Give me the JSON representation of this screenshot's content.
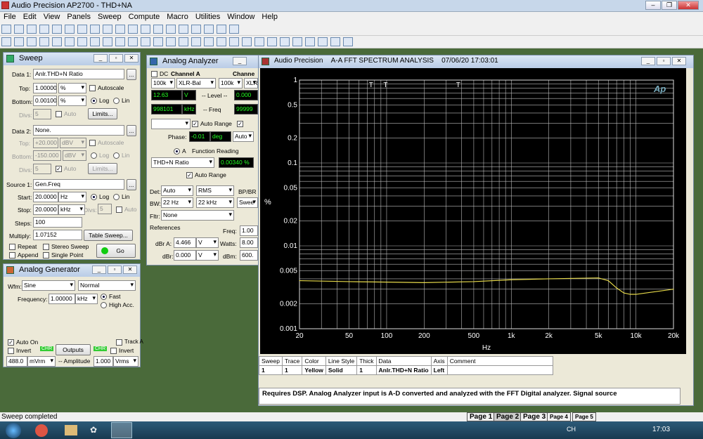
{
  "app": {
    "title": "Audio Precision AP2700 - THD+NA"
  },
  "menu": [
    "File",
    "Edit",
    "View",
    "Panels",
    "Sweep",
    "Compute",
    "Macro",
    "Utilities",
    "Window",
    "Help"
  ],
  "sweep": {
    "title": "Sweep",
    "data1_label": "Data 1:",
    "data1_value": "Anlr.THD+N Ratio",
    "top_label": "Top:",
    "top_value": "1.00000",
    "top_unit": "%",
    "bottom_label": "Bottom:",
    "bottom_value": "0.00100",
    "bottom_unit": "%",
    "autoscale": "Autoscale",
    "log": "Log",
    "lin": "Lin",
    "divs_label": "Divs:",
    "divs_value": "5",
    "auto": "Auto",
    "limits": "Limits...",
    "data2_label": "Data 2:",
    "data2_value": "None.",
    "top2_value": "+20.000",
    "top2_unit": "dBV",
    "bottom2_value": "-150.000",
    "bottom2_unit": "dBV",
    "divs2_value": "5",
    "source1_label": "Source 1:",
    "source1_value": "Gen.Freq",
    "start_label": "Start:",
    "start_value": "20.0000",
    "start_unit": "Hz",
    "stop_label": "Stop:",
    "stop_value": "20.0000",
    "stop_unit": "kHz",
    "divs3_value": "5",
    "steps_label": "Steps:",
    "steps_value": "100",
    "multiply_label": "Multiply:",
    "multiply_value": "1.07152",
    "table_sweep": "Table Sweep...",
    "repeat": "Repeat",
    "stereo_sweep": "Stereo Sweep",
    "append": "Append",
    "single_point": "Single Point",
    "go": "Go"
  },
  "generator": {
    "title": "Analog Generator",
    "wfm_label": "Wfm:",
    "wfm_value": "Sine",
    "wfm2_value": "Normal",
    "freq_label": "Frequency:",
    "freq_value": "1.00000",
    "freq_unit": "kHz",
    "fast": "Fast",
    "high_acc": "High Acc.",
    "auto_on": "Auto On",
    "invert": "Invert",
    "track_a": "Track A",
    "invert2": "Invert",
    "chr": "CHR",
    "outputs": "Outputs",
    "amp_value": "488.0",
    "amp_unit": "mVrm",
    "amp_label": "-- Amplitude",
    "amp2_value": "1.000",
    "amp2_unit": "Vrms"
  },
  "analyzer": {
    "title": "Analog Analyzer",
    "dc": "DC",
    "channel_a": "Channel A",
    "chan_b": "Channe",
    "range1": "100k",
    "input": "XLR-Bal",
    "range2": "100k",
    "input2": "XLR",
    "level_value": "12.63",
    "level_unit": "V",
    "level_label": "-- Level --",
    "level_b": "0.000",
    "freq_value": "998101",
    "freq_unit": "kHz",
    "freq_label": "-- Freq",
    "freq_b": "99999",
    "auto_range": "Auto Range",
    "phase_label": "Phase:",
    "phase_value": "-0.01",
    "phase_unit": "deg",
    "phase_auto": "Auto",
    "func_a": "A",
    "func_label": "Function Reading",
    "func_sel": "THD+N Ratio",
    "func_value": "0.00340",
    "func_unit": "%",
    "auto_range2": "Auto Range",
    "det_label": "Det:",
    "det_value": "Auto",
    "det2_value": "RMS",
    "bp_label": "BP/BR",
    "bw_label": "BW:",
    "bw_value": "22 Hz",
    "bw2_value": "22 kHz",
    "bw3_value": "Swee",
    "fltr_label": "Fltr:",
    "fltr_value": "None",
    "references": "References",
    "freq_ref_label": "Freq:",
    "freq_ref": "1.00",
    "dbra_label": "dBr A:",
    "dbra_value": "4.466",
    "dbra_unit": "V",
    "watts_label": "Watts:",
    "watts_value": "8.00",
    "dbr_label": "dBr:",
    "dbr_value": "0.000",
    "dbr_unit": "V",
    "dbm_label": "dBm:",
    "dbm_value": "600."
  },
  "graph": {
    "title_app": "Audio Precision",
    "title": "A-A FFT SPECTRUM ANALYSIS",
    "date": "07/06/20 17:03:01",
    "ap_logo": "Ap",
    "yunit": "%",
    "xunit": "Hz",
    "table_headers": [
      "Sweep",
      "Trace",
      "Color",
      "Line Style",
      "Thick",
      "Data",
      "Axis",
      "Comment"
    ],
    "table_row": [
      "1",
      "1",
      "Yellow",
      "Solid",
      "1",
      "Anlr.THD+N Ratio",
      "Left",
      ""
    ],
    "comment": "Requires DSP.  Analog Analyzer input is A-D converted and analyzed with the FFT Digital analyzer.  Signal source"
  },
  "status": {
    "text": "Sweep completed"
  },
  "pages": [
    "Page 1",
    "Page 2",
    "Page 3",
    "Page 4",
    "Page 5"
  ],
  "taskbar": {
    "lang": "CH",
    "time": "17:03"
  },
  "chart_data": {
    "type": "line",
    "x": [
      20,
      50,
      100,
      200,
      500,
      1000,
      2000,
      5000,
      6000,
      7000,
      8000,
      9000,
      10000,
      20000
    ],
    "series": [
      {
        "name": "Anlr.THD+N Ratio",
        "color": "#e6d94a",
        "values": [
          0.0038,
          0.0037,
          0.00365,
          0.0036,
          0.0037,
          0.0039,
          0.004,
          0.0041,
          0.0038,
          0.0031,
          0.0027,
          0.0026,
          0.0026,
          0.003
        ]
      }
    ],
    "xlim": [
      20,
      20000
    ],
    "ylim": [
      0.001,
      1
    ],
    "xscale": "log",
    "yscale": "log",
    "xticks": [
      "20",
      "50",
      "100",
      "200",
      "500",
      "1k",
      "2k",
      "5k",
      "10k",
      "20k"
    ],
    "yticks": [
      "1",
      "0.5",
      "0.2",
      "0.1",
      "0.05",
      "0.02",
      "0.01",
      "0.005",
      "0.002",
      "0.001"
    ],
    "xlabel": "Hz",
    "ylabel": "%",
    "markers": [
      "T",
      "T",
      "T"
    ],
    "grid": true
  }
}
